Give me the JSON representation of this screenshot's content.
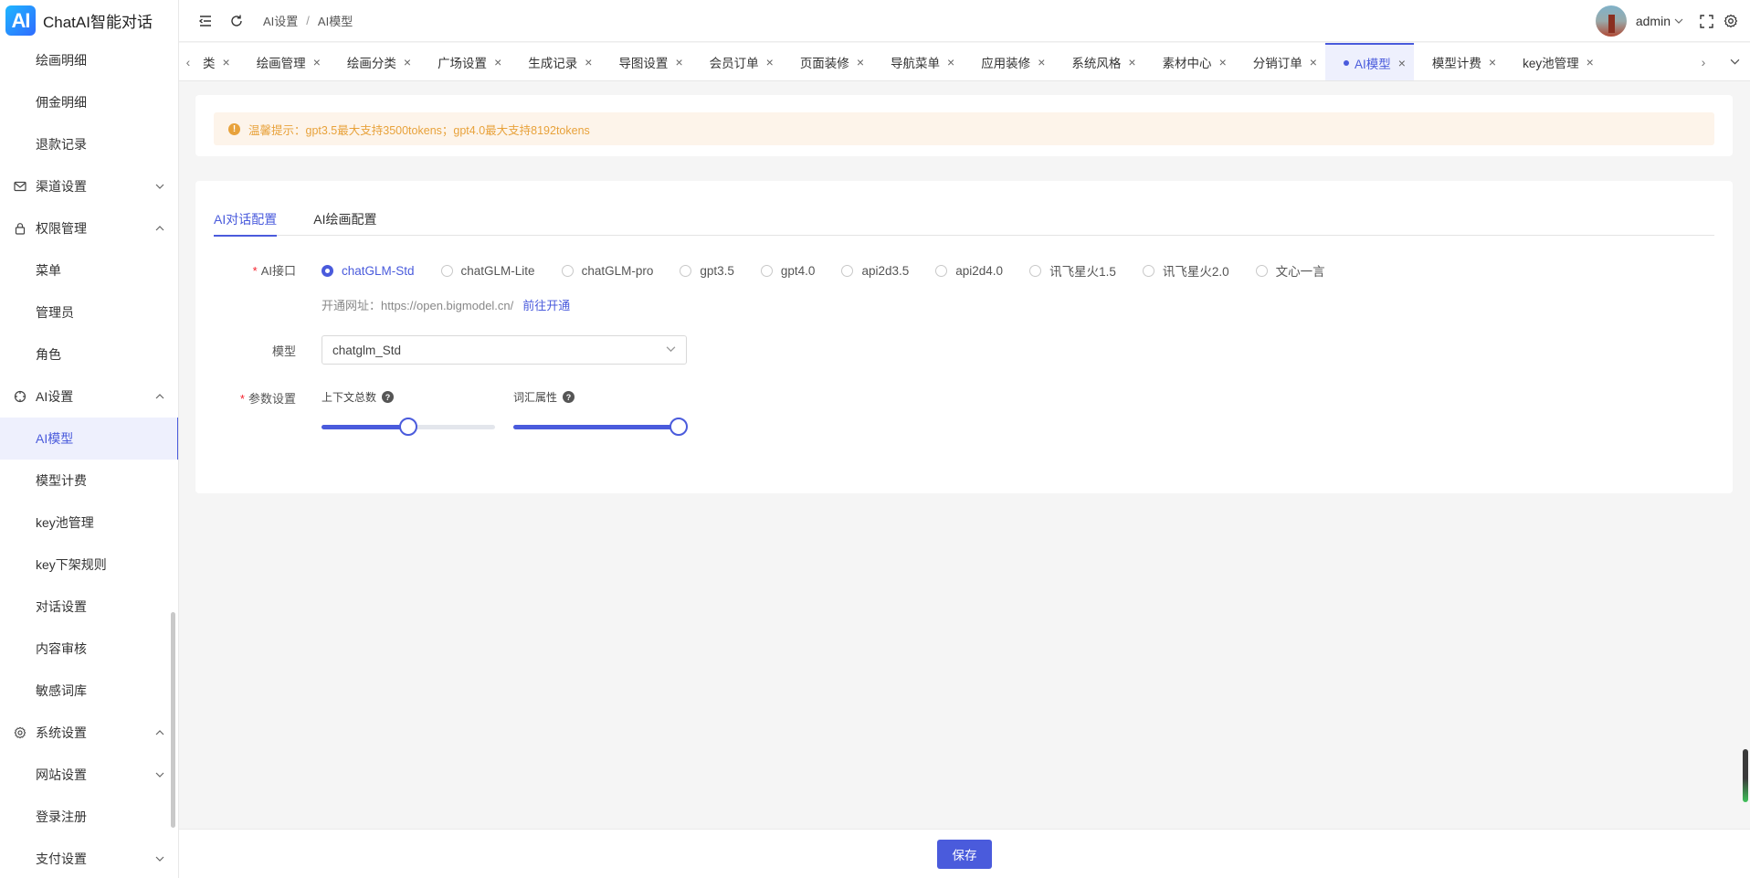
{
  "app": {
    "logo_mark": "AI",
    "title": "ChatAI智能对话"
  },
  "sidebar": {
    "items": [
      {
        "label": "绘画明细",
        "type": "child"
      },
      {
        "label": "佣金明细",
        "type": "child"
      },
      {
        "label": "退款记录",
        "type": "child"
      },
      {
        "label": "渠道设置",
        "type": "group",
        "icon": "mail-icon",
        "expanded": false
      },
      {
        "label": "权限管理",
        "type": "group",
        "icon": "lock-icon",
        "expanded": true
      },
      {
        "label": "菜单",
        "type": "child"
      },
      {
        "label": "管理员",
        "type": "child"
      },
      {
        "label": "角色",
        "type": "child"
      },
      {
        "label": "AI设置",
        "type": "group",
        "icon": "crosshair-icon",
        "expanded": true
      },
      {
        "label": "AI模型",
        "type": "child",
        "active": true
      },
      {
        "label": "模型计费",
        "type": "child"
      },
      {
        "label": "key池管理",
        "type": "child"
      },
      {
        "label": "key下架规则",
        "type": "child"
      },
      {
        "label": "对话设置",
        "type": "child"
      },
      {
        "label": "内容审核",
        "type": "child"
      },
      {
        "label": "敏感词库",
        "type": "child"
      },
      {
        "label": "系统设置",
        "type": "group",
        "icon": "gear-icon",
        "expanded": true
      },
      {
        "label": "网站设置",
        "type": "child",
        "has_children": true
      },
      {
        "label": "登录注册",
        "type": "child"
      },
      {
        "label": "支付设置",
        "type": "child",
        "has_children": true
      }
    ]
  },
  "header": {
    "breadcrumb": [
      "AI设置",
      "AI模型"
    ],
    "user": "admin"
  },
  "tabs": [
    {
      "label": "类",
      "active": false
    },
    {
      "label": "绘画管理",
      "active": false
    },
    {
      "label": "绘画分类",
      "active": false
    },
    {
      "label": "广场设置",
      "active": false
    },
    {
      "label": "生成记录",
      "active": false
    },
    {
      "label": "导图设置",
      "active": false
    },
    {
      "label": "会员订单",
      "active": false
    },
    {
      "label": "页面装修",
      "active": false
    },
    {
      "label": "导航菜单",
      "active": false
    },
    {
      "label": "应用装修",
      "active": false
    },
    {
      "label": "系统风格",
      "active": false
    },
    {
      "label": "素材中心",
      "active": false
    },
    {
      "label": "分销订单",
      "active": false
    },
    {
      "label": "AI模型",
      "active": true
    },
    {
      "label": "模型计费",
      "active": false
    },
    {
      "label": "key池管理",
      "active": false
    }
  ],
  "alert": {
    "text": "温馨提示：gpt3.5最大支持3500tokens；gpt4.0最大支持8192tokens"
  },
  "subtabs": [
    {
      "label": "AI对话配置",
      "active": true
    },
    {
      "label": "AI绘画配置",
      "active": false
    }
  ],
  "form": {
    "api_label": "AI接口",
    "api_options": [
      "chatGLM-Std",
      "chatGLM-Lite",
      "chatGLM-pro",
      "gpt3.5",
      "gpt4.0",
      "api2d3.5",
      "api2d4.0",
      "讯飞星火1.5",
      "讯飞星火2.0",
      "文心一言"
    ],
    "api_selected": "chatGLM-Std",
    "hint_prefix": "开通网址：https://open.bigmodel.cn/",
    "hint_link": "前往开通",
    "model_label": "模型",
    "model_value": "chatglm_Std",
    "params_label": "参数设置",
    "params": [
      {
        "label": "上下文总数",
        "fraction": 0.5
      },
      {
        "label": "词汇属性",
        "fraction": 1.0
      }
    ]
  },
  "footer": {
    "save_label": "保存"
  },
  "colors": {
    "accent": "#4a5bdc",
    "warning": "#e8a23b",
    "warning_bg": "#fdf4ea"
  }
}
